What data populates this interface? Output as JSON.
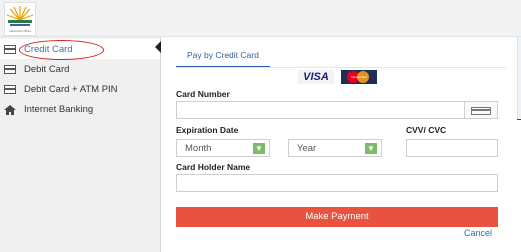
{
  "logo": {
    "caption": "India Post Office"
  },
  "sidebar": {
    "items": [
      {
        "label": "Credit Card",
        "icon": "credit-card-icon",
        "active": true
      },
      {
        "label": "Debit Card",
        "icon": "debit-card-icon"
      },
      {
        "label": "Debit Card + ATM PIN",
        "icon": "debit-card-atm-icon"
      },
      {
        "label": "Internet Banking",
        "icon": "home-icon"
      }
    ]
  },
  "tabs": [
    {
      "label": "Pay by Credit Card"
    }
  ],
  "brands": {
    "visa": "VISA",
    "mastercard": "MasterCard"
  },
  "form": {
    "card_number_label": "Card Number",
    "expiration_label": "Expiration Date",
    "cvv_label": "CVV/ CVC",
    "month_value": "Month",
    "year_value": "Year",
    "holder_label": "Card Holder Name"
  },
  "actions": {
    "pay_label": "Make Payment",
    "cancel_label": "Cancel"
  },
  "colors": {
    "accent": "#2b5ea7",
    "pay_button": "#e8523f",
    "select_arrow": "#7fb96a",
    "highlight_oval": "#d42020"
  }
}
